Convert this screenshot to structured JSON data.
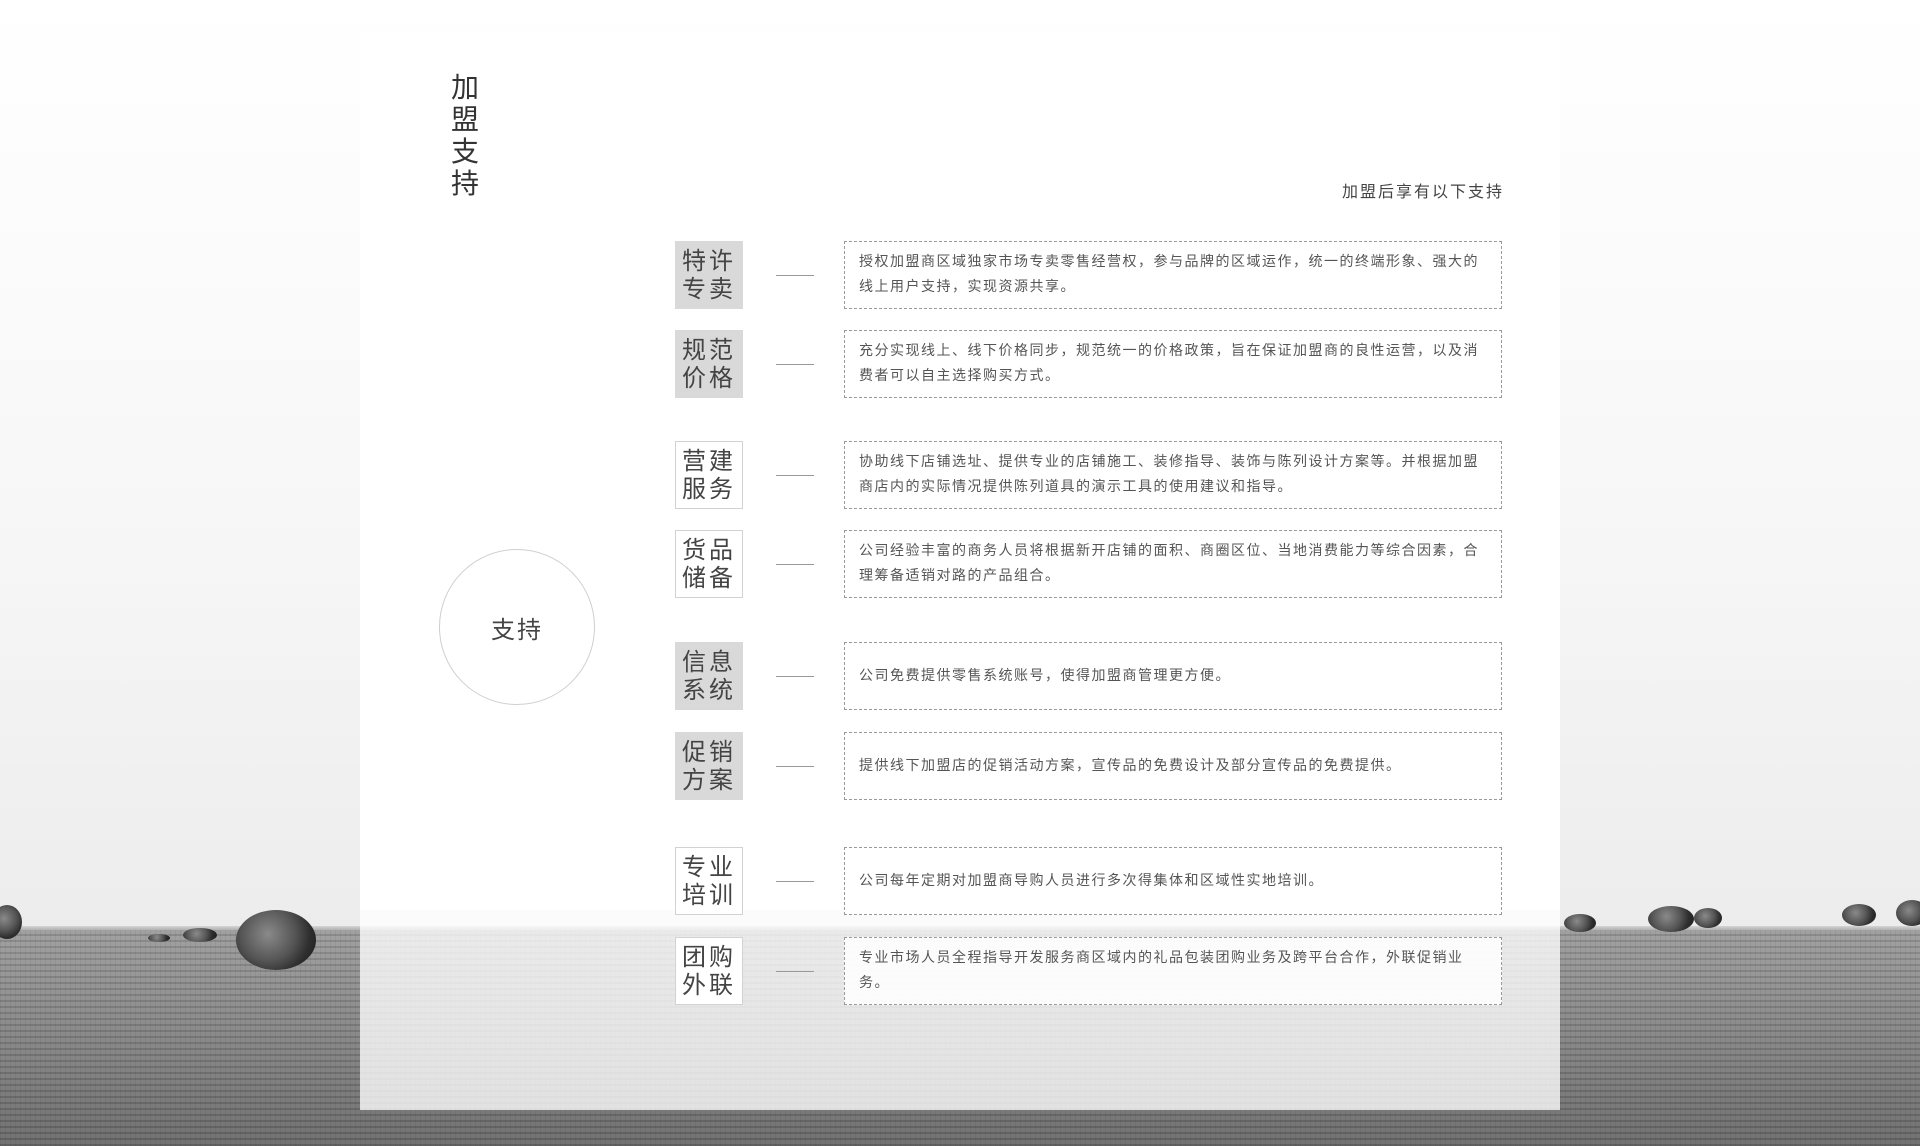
{
  "title_vertical": "加盟支持",
  "subtitle": "加盟后享有以下支持",
  "center_label": "支持",
  "items": [
    {
      "tag_line1": "特许",
      "tag_line2": "专卖",
      "description": "授权加盟商区域独家市场专卖零售经营权，参与品牌的区域运作，统一的终端形象、强大的线上用户支持，实现资源共享。"
    },
    {
      "tag_line1": "规范",
      "tag_line2": "价格",
      "description": "充分实现线上、线下价格同步，规范统一的价格政策，旨在保证加盟商的良性运营，以及消费者可以自主选择购买方式。"
    },
    {
      "tag_line1": "营建",
      "tag_line2": "服务",
      "description": "协助线下店铺选址、提供专业的店铺施工、装修指导、装饰与陈列设计方案等。并根据加盟商店内的实际情况提供陈列道具的演示工具的使用建议和指导。"
    },
    {
      "tag_line1": "货品",
      "tag_line2": "储备",
      "description": "公司经验丰富的商务人员将根据新开店铺的面积、商圈区位、当地消费能力等综合因素，合理筹备适销对路的产品组合。"
    },
    {
      "tag_line1": "信息",
      "tag_line2": "系统",
      "description": "公司免费提供零售系统账号，使得加盟商管理更方便。"
    },
    {
      "tag_line1": "促销",
      "tag_line2": "方案",
      "description": "提供线下加盟店的促销活动方案，宣传品的免费设计及部分宣传品的免费提供。"
    },
    {
      "tag_line1": "专业",
      "tag_line2": "培训",
      "description": "公司每年定期对加盟商导购人员进行多次得集体和区域性实地培训。"
    },
    {
      "tag_line1": "团购",
      "tag_line2": "外联",
      "description": "专业市场人员全程指导开发服务商区域内的礼品包装团购业务及跨平台合作，外联促销业务。"
    }
  ]
}
